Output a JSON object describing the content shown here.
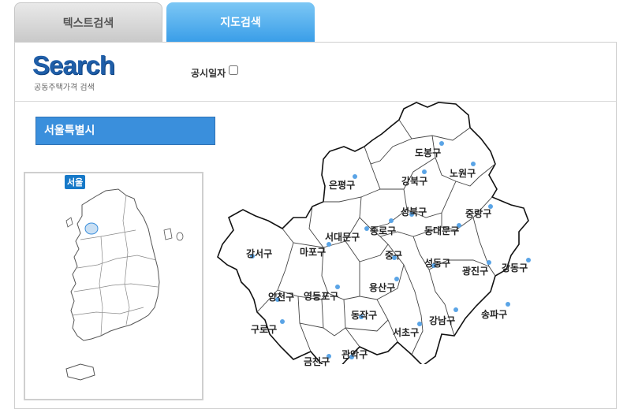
{
  "tabs": {
    "text_search": "텍스트검색",
    "map_search": "지도검색"
  },
  "header": {
    "logo": "Search",
    "subtitle": "공동주택가격 검색",
    "date_label": "공시일자"
  },
  "city": "서울특별시",
  "korea_map": {
    "highlight_label": "서울"
  },
  "districts": [
    {
      "key": "dobong",
      "name": "도봉구"
    },
    {
      "key": "nowon",
      "name": "노원구"
    },
    {
      "key": "gangbuk",
      "name": "강북구"
    },
    {
      "key": "eunpyeong",
      "name": "은평구"
    },
    {
      "key": "seongbuk",
      "name": "성북구"
    },
    {
      "key": "jungnang",
      "name": "중랑구"
    },
    {
      "key": "jongno",
      "name": "종로구"
    },
    {
      "key": "dongdaemun",
      "name": "동대문구"
    },
    {
      "key": "seodaemun",
      "name": "서대문구"
    },
    {
      "key": "gangseo",
      "name": "강서구"
    },
    {
      "key": "mapo",
      "name": "마포구"
    },
    {
      "key": "jung",
      "name": "중구"
    },
    {
      "key": "seongdong",
      "name": "성동구"
    },
    {
      "key": "gwangjin",
      "name": "광진구"
    },
    {
      "key": "gangdong",
      "name": "강동구"
    },
    {
      "key": "yongsan",
      "name": "용산구"
    },
    {
      "key": "yangcheon",
      "name": "양천구"
    },
    {
      "key": "yeongdeungpo",
      "name": "영등포구"
    },
    {
      "key": "songpa",
      "name": "송파구"
    },
    {
      "key": "gangnam",
      "name": "강남구"
    },
    {
      "key": "dongjak",
      "name": "동작구"
    },
    {
      "key": "guro",
      "name": "구로구"
    },
    {
      "key": "seocho",
      "name": "서초구"
    },
    {
      "key": "gwanak",
      "name": "관악구"
    },
    {
      "key": "geumcheon",
      "name": "금천구"
    }
  ],
  "colors": {
    "tab_active": "#3a9ee8",
    "city_bar": "#3a8fdc",
    "logo": "#1f5ea8",
    "dot": "#5aa4e6"
  }
}
